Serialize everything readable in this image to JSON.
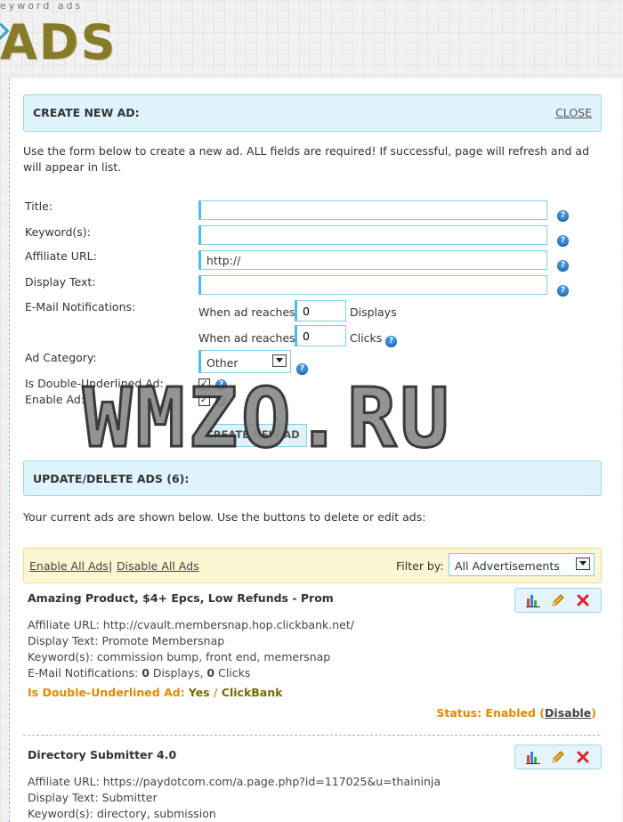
{
  "header": {
    "tagline": "eyword ads",
    "logo_text": "ADS"
  },
  "create": {
    "title": "CREATE NEW AD:",
    "close_label": "CLOSE",
    "intro": "Use the form below to create a new ad. ALL fields are required! If successful, page will refresh and ad will appear in list.",
    "labels": {
      "title": "Title:",
      "keywords": "Keyword(s):",
      "affiliate_url": "Affiliate URL:",
      "display_text": "Display Text:",
      "email": "E-Mail Notifications:",
      "category": "Ad Category:",
      "double_underlined": "Is Double-Underlined Ad:",
      "enable": "Enable Ad:"
    },
    "affiliate_url_value": "http://",
    "notif_prefix": "When ad reaches",
    "displays_value": "0",
    "displays_label": "Displays",
    "clicks_value": "0",
    "clicks_label": "Clicks",
    "category_value": "Other",
    "submit_label": "CREATE NEW AD"
  },
  "watermark": "WMZO.RU",
  "update": {
    "title": "UPDATE/DELETE ADS (6):",
    "intro": "Your current ads are shown below. Use the buttons to delete or edit ads:",
    "enable_all": "Enable All Ads",
    "separator": "|",
    "disable_all": "Disable All Ads",
    "filter_label": "Filter by:",
    "filter_value": "All Advertisements"
  },
  "ads": [
    {
      "title": "Amazing Product, $4+ Epcs, Low Refunds - Prom",
      "affiliate_url": "Affiliate URL: http://cvault.membersnap.hop.clickbank.net/",
      "display_text": "Display Text: Promote Membersnap",
      "keywords": "Keyword(s): commission bump, front end, memersnap",
      "notif_prefix": "E-Mail Notifications: ",
      "displays": "0",
      "displays_word": " Displays, ",
      "clicks": "0",
      "clicks_word": " Clicks",
      "du_label": "Is Double-Underlined Ad:",
      "du_value": "Yes",
      "du_sep": " / ",
      "category": "ClickBank",
      "status_label": "Status: Enabled (",
      "status_action": "Disable",
      "status_close": ")"
    },
    {
      "title": "Directory Submitter 4.0",
      "affiliate_url": "Affiliate URL: https://paydotcom.com/a.page.php?id=117025&u=thaininja",
      "display_text": "Display Text: Submitter",
      "keywords": "Keyword(s): directory, submission"
    }
  ]
}
